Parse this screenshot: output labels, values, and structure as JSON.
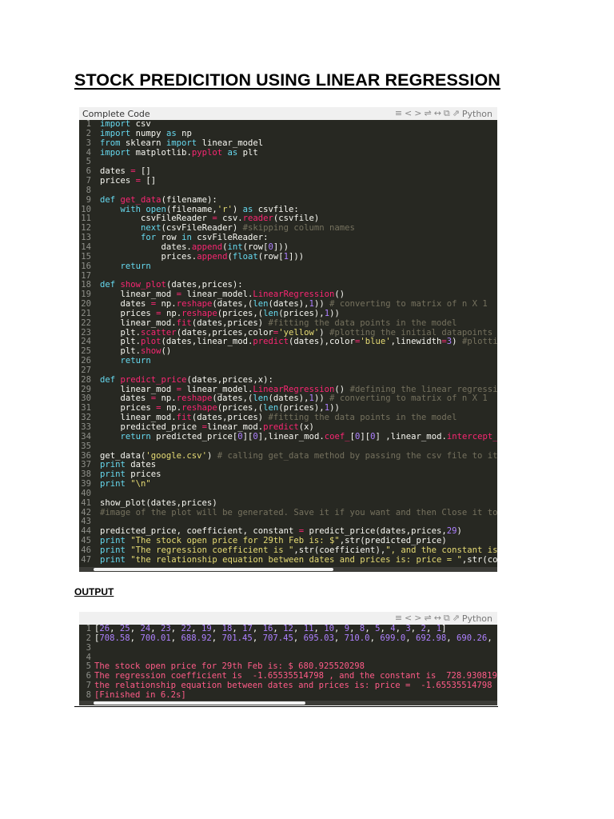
{
  "document_title": "STOCK PREDICITION USING LINEAR REGRESSION",
  "code_panel": {
    "header": "Complete Code",
    "icons": [
      "lines-icon",
      "code-icon",
      "wrap-icon",
      "expand-icon",
      "copy-icon",
      "popout-icon"
    ],
    "language": "Python",
    "lines": [
      {
        "n": "1",
        "t": "import csv"
      },
      {
        "n": "2",
        "t": "import numpy as np"
      },
      {
        "n": "3",
        "t": "from sklearn import linear_model"
      },
      {
        "n": "4",
        "t": "import matplotlib.pyplot as plt"
      },
      {
        "n": "5",
        "t": ""
      },
      {
        "n": "6",
        "t": "dates = []"
      },
      {
        "n": "7",
        "t": "prices = []"
      },
      {
        "n": "8",
        "t": ""
      },
      {
        "n": "9",
        "t": "def get_data(filename):"
      },
      {
        "n": "10",
        "t": "    with open(filename,'r') as csvfile:"
      },
      {
        "n": "11",
        "t": "        csvFileReader = csv.reader(csvfile)"
      },
      {
        "n": "12",
        "t": "        next(csvFileReader) #skipping column names"
      },
      {
        "n": "13",
        "t": "        for row in csvFileReader:"
      },
      {
        "n": "14",
        "t": "            dates.append(int(row[0]))"
      },
      {
        "n": "15",
        "t": "            prices.append(float(row[1]))"
      },
      {
        "n": "16",
        "t": "    return"
      },
      {
        "n": "17",
        "t": ""
      },
      {
        "n": "18",
        "t": "def show_plot(dates,prices):"
      },
      {
        "n": "19",
        "t": "    linear_mod = linear_model.LinearRegression()"
      },
      {
        "n": "20",
        "t": "    dates = np.reshape(dates,(len(dates),1)) # converting to matrix of n X 1"
      },
      {
        "n": "21",
        "t": "    prices = np.reshape(prices,(len(prices),1))"
      },
      {
        "n": "22",
        "t": "    linear_mod.fit(dates,prices) #fitting the data points in the model"
      },
      {
        "n": "23",
        "t": "    plt.scatter(dates,prices,color='yellow') #plotting the initial datapoints"
      },
      {
        "n": "24",
        "t": "    plt.plot(dates,linear_mod.predict(dates),color='blue',linewidth=3) #plottin"
      },
      {
        "n": "25",
        "t": "    plt.show()"
      },
      {
        "n": "26",
        "t": "    return"
      },
      {
        "n": "27",
        "t": ""
      },
      {
        "n": "28",
        "t": "def predict_price(dates,prices,x):"
      },
      {
        "n": "29",
        "t": "    linear_mod = linear_model.LinearRegression() #defining the linear regressio"
      },
      {
        "n": "30",
        "t": "    dates = np.reshape(dates,(len(dates),1)) # converting to matrix of n X 1"
      },
      {
        "n": "31",
        "t": "    prices = np.reshape(prices,(len(prices),1))"
      },
      {
        "n": "32",
        "t": "    linear_mod.fit(dates,prices) #fitting the data points in the model"
      },
      {
        "n": "33",
        "t": "    predicted_price =linear_mod.predict(x)"
      },
      {
        "n": "34",
        "t": "    return predicted_price[0][0],linear_mod.coef_[0][0] ,linear_mod.intercept_["
      },
      {
        "n": "35",
        "t": ""
      },
      {
        "n": "36",
        "t": "get_data('google.csv') # calling get_data method by passing the csv file to it"
      },
      {
        "n": "37",
        "t": "print dates"
      },
      {
        "n": "38",
        "t": "print prices"
      },
      {
        "n": "39",
        "t": "print \"\\n\""
      },
      {
        "n": "40",
        "t": ""
      },
      {
        "n": "41",
        "t": "show_plot(dates,prices)"
      },
      {
        "n": "42",
        "t": "#image of the plot will be generated. Save it if you want and then Close it to"
      },
      {
        "n": "43",
        "t": ""
      },
      {
        "n": "44",
        "t": "predicted_price, coefficient, constant = predict_price(dates,prices,29)"
      },
      {
        "n": "45",
        "t": "print \"The stock open price for 29th Feb is: $\",str(predicted_price)"
      },
      {
        "n": "46",
        "t": "print \"The regression coefficient is \",str(coefficient),\", and the constant is"
      },
      {
        "n": "47",
        "t": "print \"the relationship equation between dates and prices is: price = \",str(coe"
      }
    ]
  },
  "output_label": "OUTPUT",
  "output_panel": {
    "icons": [
      "lines-icon",
      "code-icon",
      "wrap-icon",
      "expand-icon",
      "copy-icon",
      "popout-icon"
    ],
    "language": "Python",
    "lines": [
      {
        "n": "1",
        "t": "[26, 25, 24, 23, 22, 19, 18, 17, 16, 12, 11, 10, 9, 8, 5, 4, 3, 2, 1]"
      },
      {
        "n": "2",
        "t": "[708.58, 700.01, 688.92, 701.45, 707.45, 695.03, 710.0, 699.0, 692.98, 690.26, 6"
      },
      {
        "n": "3",
        "t": ""
      },
      {
        "n": "4",
        "t": ""
      },
      {
        "n": "5",
        "t": "The stock open price for 29th Feb is: $ 680.925520298"
      },
      {
        "n": "6",
        "t": "The regression coefficient is  -1.65535514798 , and the constant is  728.9308195"
      },
      {
        "n": "7",
        "t": "the relationship equation between dates and prices is: price =  -1.65535514798 *"
      },
      {
        "n": "8",
        "t": "[Finished in 6.2s]"
      }
    ]
  },
  "colors": {
    "code_bg": "#272822",
    "keyword": "#66d9ef",
    "operator": "#f92672",
    "string": "#e6db74",
    "comment": "#75715e",
    "number": "#ae81ff",
    "output_text": "#ff5b88"
  }
}
